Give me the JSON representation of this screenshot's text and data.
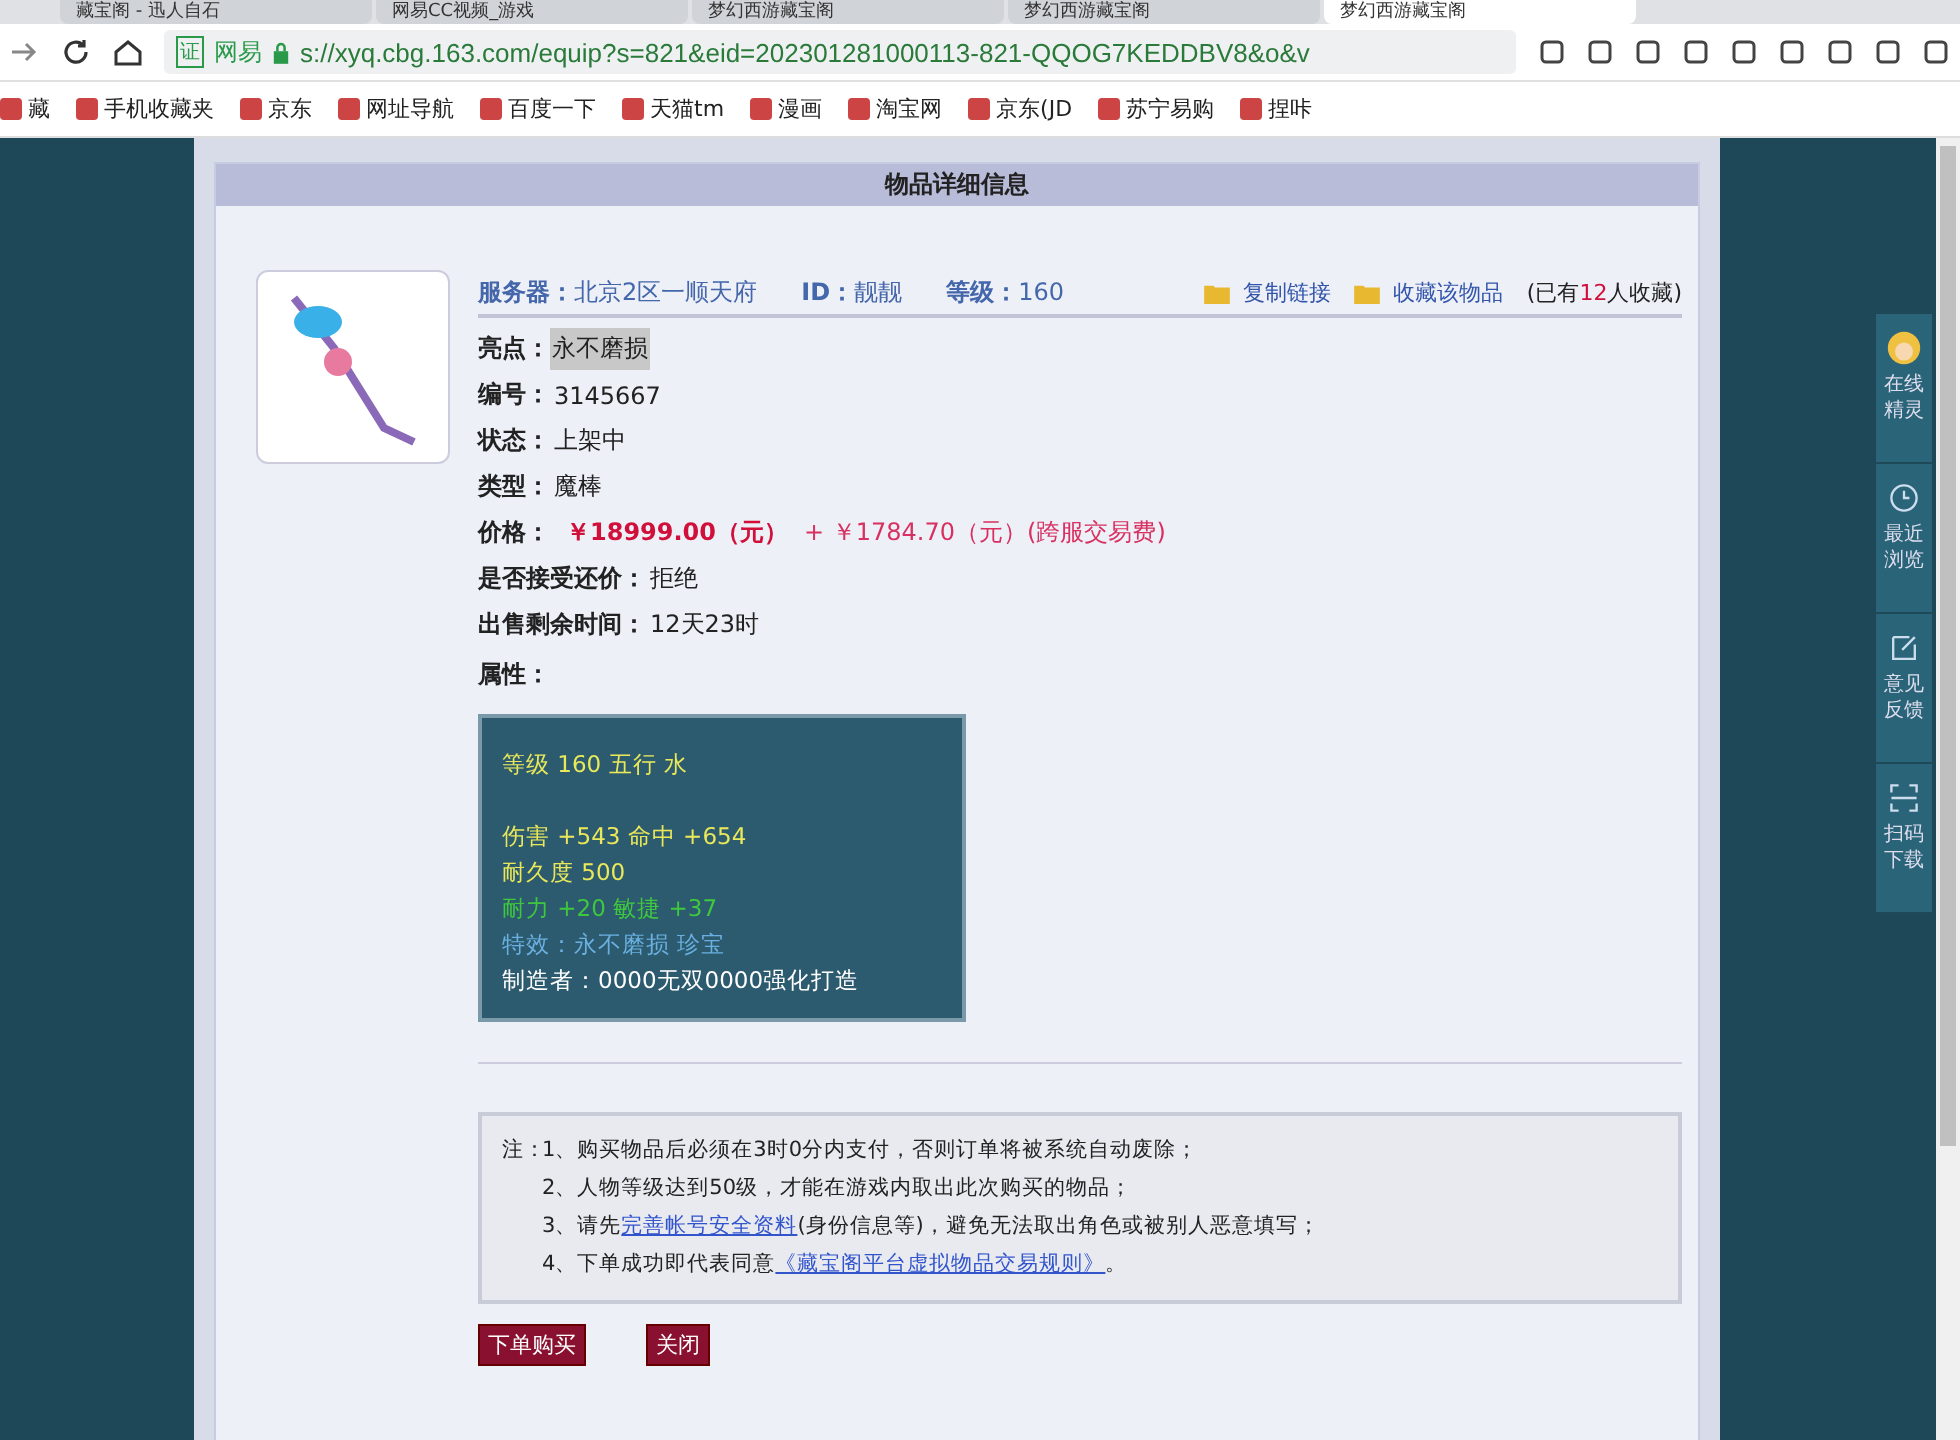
{
  "browser": {
    "tabs": [
      {
        "title": "藏宝阁 - 迅人自石",
        "selected": false
      },
      {
        "title": "网易CC视频_游戏",
        "selected": false
      },
      {
        "title": "梦幻西游藏宝阁",
        "selected": false
      },
      {
        "title": "梦幻西游藏宝阁",
        "selected": false
      },
      {
        "title": "梦幻西游藏宝阁",
        "selected": true
      }
    ],
    "cert_label": "证",
    "site_label": "网易",
    "url": "s://xyq.cbg.163.com/equip?s=821&eid=202301281000113-821-QQOG7KEDDBV8&o&v",
    "bookmarks": [
      "藏",
      "手机收藏夹",
      "京东",
      "网址导航",
      "百度一下",
      "天猫tm",
      "漫画",
      "淘宝网",
      "京东(JD",
      "苏宁易购",
      "捏咔"
    ]
  },
  "panel": {
    "title": "物品详细信息",
    "meta": [
      {
        "label": "服务器：",
        "value": "北京2区一顺天府"
      },
      {
        "label": "ID：",
        "value": "靓靓"
      },
      {
        "label": "等级：",
        "value": "160"
      }
    ],
    "copy_link": "复制链接",
    "favorite": "收藏该物品",
    "favorite_count": {
      "before": "(已有",
      "number": "12",
      "after": "人收藏)"
    },
    "fields": [
      {
        "label": "亮点：",
        "value": "永不磨损",
        "kind": "highlight"
      },
      {
        "label": "编号：",
        "value": "3145667",
        "kind": "plain"
      },
      {
        "label": "状态：",
        "value": "上架中",
        "kind": "plain"
      },
      {
        "label": "类型：",
        "value": "魔棒",
        "kind": "plain"
      },
      {
        "label": "价格：",
        "value": "￥18999.00（元）",
        "extra": "+ ￥1784.70（元）(跨服交易费)",
        "kind": "price"
      },
      {
        "label": "是否接受还价：",
        "value": "拒绝",
        "kind": "plain"
      },
      {
        "label": "出售剩余时间：",
        "value": "12天23时",
        "kind": "plain"
      },
      {
        "label": "属性：",
        "kind": "heading"
      }
    ],
    "attribute_groups": [
      [
        {
          "text": "等级 160 五行 水",
          "color": "#e8e85a"
        }
      ],
      [
        {
          "text": "伤害 +543 命中 +654",
          "color": "#e8e85a"
        },
        {
          "text": "耐久度 500",
          "color": "#e8e85a"
        },
        {
          "text": "耐力 +20 敏捷 +37",
          "color": "#3ec83e"
        },
        {
          "text": "特效：永不磨损 珍宝",
          "color": "#6ab0e0"
        },
        {
          "text": "制造者：0000无双0000强化打造",
          "color": "#ffffff"
        }
      ]
    ],
    "notes": [
      {
        "prefix": "注：",
        "text": "1、购买物品后必须在3时0分内支付，否则订单将被系统自动废除；"
      },
      {
        "text": "2、人物等级达到50级，才能在游戏内取出此次购买的物品；"
      },
      {
        "text": "3、请先",
        "link": "完善帐号安全资料",
        "after": "(身份信息等)，避免无法取出角色或被别人恶意填写；"
      },
      {
        "text": "4、下单成功即代表同意",
        "link": "《藏宝阁平台虚拟物品交易规则》",
        "after": "。"
      }
    ],
    "buttons": [
      "下单购买",
      "关闭"
    ]
  },
  "side_dock": [
    {
      "label": "在线精灵",
      "kind": "avatar"
    },
    {
      "label": "最近浏览",
      "kind": "clock"
    },
    {
      "label": "意见反馈",
      "kind": "edit"
    },
    {
      "label": "扫码下载",
      "kind": "scan"
    }
  ]
}
